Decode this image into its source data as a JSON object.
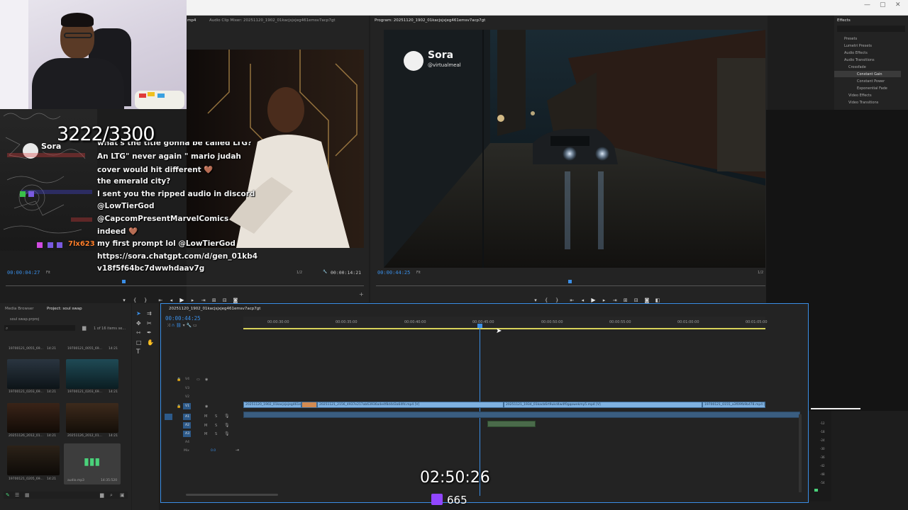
{
  "source_monitor": {
    "tab_active": "mp4",
    "tab_audio_mixer": "Audio Clip Mixer: 20251120_1902_01kacjsjxjeg461emsv7acp7gt",
    "timecode": "00:00:04:27",
    "fit": "Fit",
    "fraction": "1/2",
    "duration": "00:00:14:21"
  },
  "program_monitor": {
    "tab": "Program: 20251120_1902_01kacjsjxjeg461emsv7acp7gt",
    "timecode": "00:00:44:25",
    "fit": "Fit",
    "fraction": "1/2",
    "watermark_name": "Sora",
    "watermark_handle": "@virtualmeal"
  },
  "effects": {
    "tab": "Effects",
    "items": [
      "Presets",
      "Lumetri Presets",
      "Audio Effects",
      "Audio Transitions",
      "Crossfade",
      "Constant Gain",
      "Constant Power",
      "Exponential Fade",
      "Video Effects",
      "Video Transitions"
    ]
  },
  "project": {
    "tab_media_browser": "Media Browser",
    "tab_project": "Project: soul swap",
    "file": "soul swap.prproj",
    "count": "1 of 16 items se...",
    "thumbs": [
      {
        "name": "19700121_0055_69...",
        "dur": "14:21"
      },
      {
        "name": "19700121_0055_69...",
        "dur": "14:21"
      },
      {
        "name": "19700121_0203_69...",
        "dur": "14:21"
      },
      {
        "name": "19700121_0203_69...",
        "dur": "14:21"
      },
      {
        "name": "20251126_2012_01...",
        "dur": "14:21"
      },
      {
        "name": "20251126_2012_01...",
        "dur": "14:21"
      },
      {
        "name": "19700121_0205_69...",
        "dur": "14:21"
      },
      {
        "name": "audio.mp3",
        "dur": "14:35:520"
      }
    ]
  },
  "timeline": {
    "tab": "20251120_1902_01kacjsjxjeg461emsv7acp7gt",
    "timecode": "00:00:44:25",
    "ruler": [
      "00:00:30:00",
      "00:00:35:00",
      "00:00:40:00",
      "00:00:45:00",
      "00:00:50:00",
      "00:00:55:00",
      "00:01:00:00",
      "00:01:05:00"
    ],
    "video_tracks": [
      "V4",
      "V3",
      "V2",
      "V1"
    ],
    "audio_tracks": [
      "A1",
      "A2",
      "A3",
      "A4"
    ],
    "mix_label": "Mix",
    "mix_value": "0.0",
    "clips": [
      "20251120_1902_01kacjsjxjeg461emsv7acp7gt.mp4 [V]",
      "20251121_2156_4937e217ab63936a4e4f8d4d3a64fd.mp4 [V]",
      "20251121_1934_01kacb6rt9ukd4w4f0gqowekmy5.mp4 [V]",
      "19700121_0155_a3f09fb9b478.mp4 [V]"
    ],
    "meter_labels": [
      "-12",
      "-18",
      "-24",
      "-30",
      "-36",
      "-42",
      "-48",
      "-54"
    ]
  },
  "stream": {
    "counter": "3222/3300",
    "timer": "02:50:26",
    "viewers": "665",
    "sora_label": "Sora",
    "chat": [
      {
        "user": "",
        "text": "what's the title gonna be called LTG?",
        "color": "#ffffff"
      },
      {
        "user": "",
        "text": "An LTG\" never again \" mario judah",
        "color": "#ffffff"
      },
      {
        "user": "",
        "text": "cover would hit different 🤎",
        "color": "#ffffff"
      },
      {
        "user": "",
        "text": "the emerald city?",
        "color": "#ffffff"
      },
      {
        "user": "",
        "text": "I sent you the ripped audio in discord",
        "color": "#ffffff"
      },
      {
        "user": "",
        "text": "@LowTierGod",
        "color": "#ffffff"
      },
      {
        "user": "",
        "text": "@CapcomPresentMarvelComics",
        "color": "#ffffff"
      },
      {
        "user": "",
        "text": "indeed 🤎",
        "color": "#ffffff"
      },
      {
        "user": "7lx623",
        "text": "my first prompt lol @LowTierGod",
        "color": "#ff7f2a"
      },
      {
        "user": "",
        "text": "https://sora.chatgpt.com/d/gen_01kb4",
        "color": "#ffffff"
      },
      {
        "user": "",
        "text": "v18f5f64bc7dwwhdaav7g",
        "color": "#ffffff"
      }
    ]
  }
}
